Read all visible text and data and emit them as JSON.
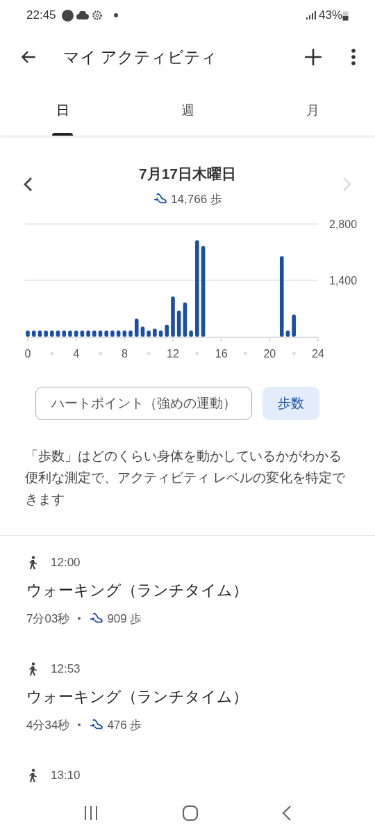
{
  "status_bar": {
    "time": "22:45",
    "battery": "43%"
  },
  "app_bar": {
    "title": "マイ アクティビティ"
  },
  "tabs": [
    {
      "label": "日",
      "selected": true
    },
    {
      "label": "週",
      "selected": false
    },
    {
      "label": "月",
      "selected": false
    }
  ],
  "day": {
    "date": "7月17日木曜日",
    "steps": "14,766 歩",
    "next_disabled": true
  },
  "chart_data": {
    "type": "bar",
    "x": [
      0,
      0.5,
      1,
      1.5,
      2,
      2.5,
      3,
      3.5,
      4,
      4.5,
      5,
      5.5,
      6,
      6.5,
      7,
      7.5,
      8,
      8.5,
      9,
      9.5,
      10,
      10.5,
      11,
      11.5,
      12,
      12.5,
      13,
      13.5,
      14,
      14.5,
      21,
      21.5,
      22
    ],
    "series": [
      {
        "color": "#1a4fa8",
        "values": [
          150,
          150,
          150,
          150,
          150,
          150,
          150,
          150,
          150,
          150,
          150,
          150,
          150,
          150,
          150,
          150,
          150,
          150,
          450,
          250,
          150,
          200,
          150,
          300,
          1000,
          650,
          850,
          150,
          2400,
          2250,
          2000,
          150,
          550
        ]
      }
    ],
    "xlim": [
      0,
      24
    ],
    "ylim": [
      0,
      2800
    ],
    "xticks": [
      0,
      4,
      8,
      12,
      16,
      20,
      24
    ],
    "yticks": [
      {
        "value": 1400,
        "label": "1,400"
      },
      {
        "value": 2800,
        "label": "2,800"
      }
    ]
  },
  "metric_chips": [
    {
      "label": "ハートポイント（強めの運動）",
      "selected": false
    },
    {
      "label": "歩数",
      "selected": true
    }
  ],
  "description": "「歩数」はどのくらい身体を動かしているかがわかる便利な測定で、アクティビティ レベルの変化を特定できます",
  "activities": [
    {
      "time": "12:00",
      "title": "ウォーキング（ランチタイム）",
      "duration": "7分03秒",
      "steps": "909 歩"
    },
    {
      "time": "12:53",
      "title": "ウォーキング（ランチタイム）",
      "duration": "4分34秒",
      "steps": "476 歩"
    },
    {
      "time": "13:10"
    }
  ]
}
